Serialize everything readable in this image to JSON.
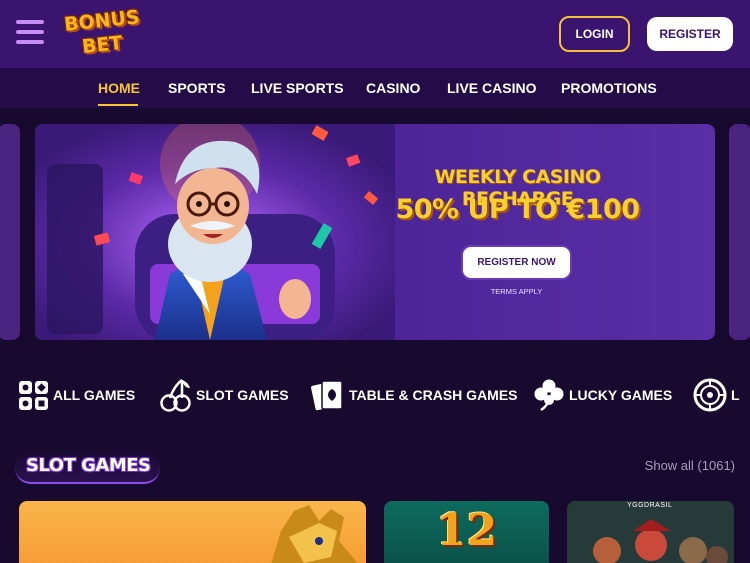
{
  "header": {
    "logo": {
      "line1": "BONUS",
      "line2": "BET"
    },
    "login_label": "LOGIN",
    "register_label": "REGISTER"
  },
  "nav": {
    "items": [
      {
        "label": "HOME",
        "active": true
      },
      {
        "label": "SPORTS",
        "active": false
      },
      {
        "label": "LIVE SPORTS",
        "active": false
      },
      {
        "label": "CASINO",
        "active": false
      },
      {
        "label": "LIVE CASINO",
        "active": false
      },
      {
        "label": "PROMOTIONS",
        "active": false
      }
    ]
  },
  "banner": {
    "title": "WEEKLY CASINO RECHARGE",
    "subtitle": "50% UP TO €100",
    "cta_label": "REGISTER NOW",
    "terms_label": "TERMS APPLY"
  },
  "categories": [
    {
      "label": "ALL GAMES",
      "icon": "grid-icon"
    },
    {
      "label": "SLOT GAMES",
      "icon": "cherries-icon"
    },
    {
      "label": "TABLE & CRASH GAMES",
      "icon": "cards-icon"
    },
    {
      "label": "LUCKY GAMES",
      "icon": "clover-icon"
    },
    {
      "label": "L",
      "icon": "roulette-icon"
    }
  ],
  "section": {
    "title": "SLOT GAMES",
    "show_all": "Show all (1061)"
  },
  "games": [
    {
      "name": "egyptian-slot",
      "art_text": ""
    },
    {
      "name": "12-coins",
      "art_text": "12"
    },
    {
      "name": "pirates-slot",
      "art_text": "YGGDRASIL"
    }
  ],
  "colors": {
    "header_bg": "#3b1470",
    "nav_bg": "#240c48",
    "page_bg": "#170a2e",
    "accent_yellow": "#f7c531",
    "banner_purple": "#5b2aa3"
  }
}
